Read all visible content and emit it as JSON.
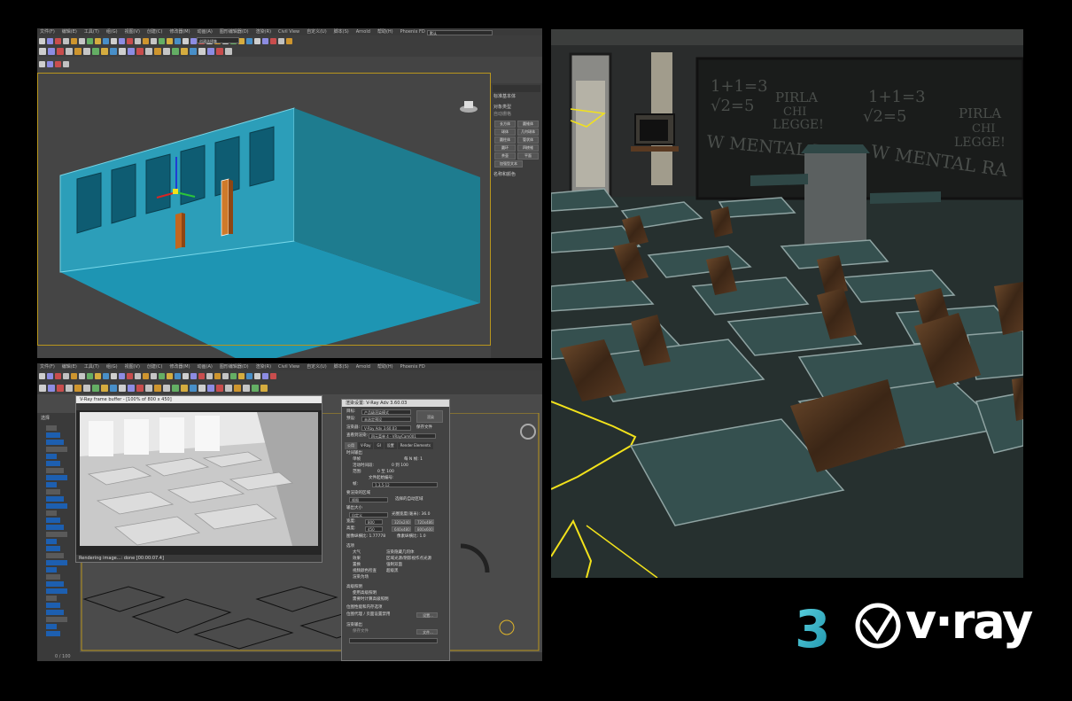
{
  "top_viewport": {
    "menu": [
      "文件(F)",
      "编辑(E)",
      "工具(T)",
      "组(G)",
      "视图(V)",
      "创建(C)",
      "修改器(M)",
      "动画(A)",
      "图形编辑器(D)",
      "渲染(R)",
      "Civil View",
      "自定义(U)",
      "脚本(S)",
      "Arnold",
      "帮助(H)",
      "Phoenix FD"
    ],
    "workspace_value": "默认",
    "selection_set": "创建选择集",
    "cmd_panel": {
      "header": "标准基本体",
      "rollout_object_type": "对象类型",
      "autogrid": "自动栅格",
      "buttons": [
        "长方体",
        "圆锥体",
        "球体",
        "几何球体",
        "圆柱体",
        "管状体",
        "圆环",
        "四棱锥",
        "茶壶",
        "平面",
        "加强型文本"
      ],
      "rollout_name_color": "名称和颜色"
    }
  },
  "bottom_viewport": {
    "menu": [
      "文件(F)",
      "编辑(E)",
      "工具(T)",
      "组(G)",
      "视图(V)",
      "创建(C)",
      "修改器(M)",
      "动画(A)",
      "图形编辑器(D)",
      "渲染(R)",
      "Civil View",
      "自定义(U)",
      "脚本(S)",
      "Arnold",
      "帮助(H)",
      "Phoenix FD"
    ],
    "scene_label": "选择",
    "status_left": "0 / 100",
    "vfb": {
      "title": "V-Ray frame buffer - [100% of 800 x 450]",
      "status": "Rendering image...: done [00:00:07.4]"
    },
    "render_setup": {
      "title": "渲染设置: V-Ray Adv 3.60.03",
      "target_label": "目标:",
      "target_value": "产品级渲染模式",
      "preset_label": "预设:",
      "preset_value": "未选定预设",
      "renderer_label": "渲染器:",
      "renderer_value": "V-Ray Adv 3.60.03",
      "save_file": "保存文件",
      "view_label": "查看到渲染:",
      "view_value": "四元菜单 4 - VRayCam001",
      "render_btn": "渲染",
      "tabs": [
        "公用",
        "V-Ray",
        "GI",
        "设置",
        "Render Elements"
      ],
      "section_time": "时间输出",
      "single": "单帧",
      "every_n": "每 N 帧: 1",
      "active_segment": "活动时间段:",
      "active_range": "0 到 100",
      "range": "范围:",
      "range_vals": "0 至 100",
      "file_start": "文件起始编号:",
      "frames": "帧:",
      "frames_val": "1,3,5-12",
      "area_label": "要渲染的区域",
      "area_value": "视图",
      "auto_region": "选择的自动区域",
      "output_size": "输出大小",
      "output_size_value": "自定义",
      "aperture": "光圈宽度(毫米): 36.0",
      "width_label": "宽度:",
      "width_val": "800",
      "height_label": "高度:",
      "height_val": "450",
      "res_a": "320x240",
      "res_b": "720x486",
      "res_c": "640x480",
      "res_d": "800x600",
      "img_aspect": "图像纵横比: 1.77778",
      "pixel_aspect": "像素纵横比: 1.0",
      "options": "选项",
      "opt1": "大气",
      "opt2": "效果",
      "opt3": "置换",
      "opt4": "视频颜色检查",
      "opt5": "渲染为场",
      "opt6": "渲染隐藏几何体",
      "opt7": "区域光源/阴影视作点光源",
      "opt8": "强制双面",
      "opt9": "超级黑",
      "adv_light": "高级照明",
      "adv1": "使用高级照明",
      "adv2": "需要时计算高级照明",
      "bitmap_perf": "位图性能和内存选项",
      "bitmap_proxy": "位图代理 / 页面设置禁用",
      "settings_btn": "设置...",
      "render_output": "渲染输出",
      "save_files": "保存文件",
      "files_btn": "文件..."
    }
  },
  "classroom": {
    "board_left": [
      "1+1=3",
      "√2=5",
      "PIRLA",
      "CHI",
      "LEGGE!",
      "W MENTAL RAY!"
    ],
    "board_right": [
      "1+1=3",
      "√2=5",
      "PIRLA",
      "CHI",
      "LEGGE!",
      "W MENTAL RA"
    ]
  },
  "branding": {
    "max_logo": "3",
    "vray_text": "v·ray"
  },
  "colors": {
    "max_logo": "#2fb6c9",
    "wireframe_cyan": "#27a9c8",
    "selection_yellow": "#f2e21b",
    "desk_top": "#35504f",
    "chair_wood": "#5a3a22"
  }
}
